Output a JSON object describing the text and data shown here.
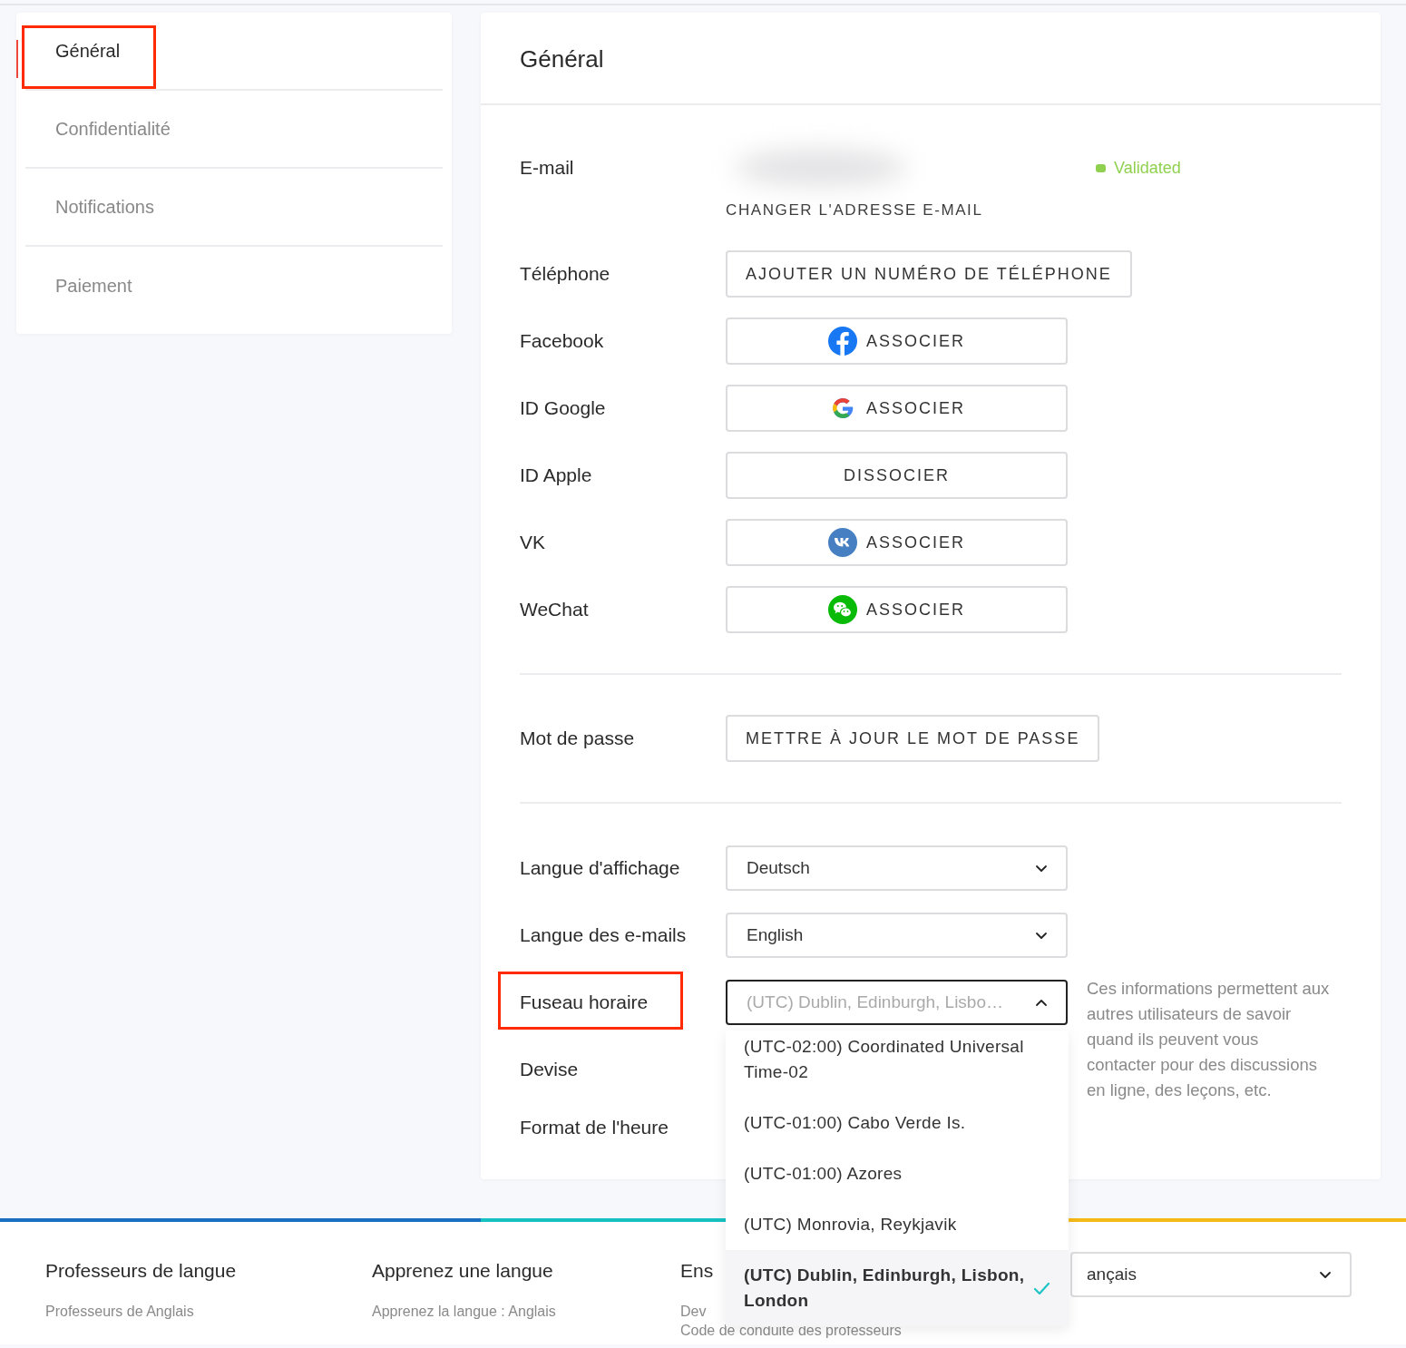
{
  "sidebar": {
    "items": [
      {
        "label": "Général",
        "selected": true,
        "highlighted": true
      },
      {
        "label": "Confidentialité",
        "selected": false,
        "highlighted": false
      },
      {
        "label": "Notifications",
        "selected": false,
        "highlighted": false
      },
      {
        "label": "Paiement",
        "selected": false,
        "highlighted": false
      }
    ]
  },
  "main": {
    "title": "Général",
    "email": {
      "label": "E-mail",
      "status": "Validated",
      "change_link": "CHANGER L'ADRESSE E-MAIL"
    },
    "accounts": [
      {
        "label": "Téléphone",
        "button": "AJOUTER UN NUMÉRO DE TÉLÉPHONE",
        "kind": "plain"
      },
      {
        "label": "Facebook",
        "button": "ASSOCIER",
        "kind": "facebook"
      },
      {
        "label": "ID Google",
        "button": "ASSOCIER",
        "kind": "google"
      },
      {
        "label": "ID Apple",
        "button": "DISSOCIER",
        "kind": "plain"
      },
      {
        "label": "VK",
        "button": "ASSOCIER",
        "kind": "vk"
      },
      {
        "label": "WeChat",
        "button": "ASSOCIER",
        "kind": "wechat"
      }
    ],
    "password": {
      "label": "Mot de passe",
      "button": "METTRE À JOUR LE MOT DE PASSE"
    },
    "preferences": [
      {
        "label": "Langue d'affichage",
        "value": "Deutsch",
        "open": false,
        "highlighted": false
      },
      {
        "label": "Langue des e-mails",
        "value": "English",
        "open": false,
        "highlighted": false
      },
      {
        "label": "Fuseau horaire",
        "value": "(UTC) Dublin, Edinburgh, Lisbo…",
        "open": true,
        "highlighted": true,
        "options": [
          {
            "label": "(UTC-02:00) Coordinated Universal Time-02",
            "selected": false
          },
          {
            "label": "(UTC-01:00) Cabo Verde Is.",
            "selected": false
          },
          {
            "label": "(UTC-01:00) Azores",
            "selected": false
          },
          {
            "label": "(UTC) Monrovia, Reykjavik",
            "selected": false
          },
          {
            "label": "(UTC) Dublin, Edinburgh, Lisbon, London",
            "selected": true
          }
        ]
      },
      {
        "label": "Devise",
        "highlighted": false
      },
      {
        "label": "Format de l'heure",
        "highlighted": false
      }
    ],
    "timezone_hint": "Ces informations permettent aux autres utilisateurs de savoir quand ils peuvent vous contacter pour des discussions en ligne, des leçons, etc."
  },
  "footer": {
    "columns": [
      {
        "title": "Professeurs de langue",
        "links": [
          "Professeurs de Anglais"
        ]
      },
      {
        "title": "Apprenez une langue",
        "links": [
          "Apprenez la langue : Anglais"
        ]
      },
      {
        "title": "Ens",
        "links": [
          "Dev",
          "Code de conduite des professeurs"
        ]
      }
    ],
    "language_select": {
      "value": "ançais"
    }
  }
}
